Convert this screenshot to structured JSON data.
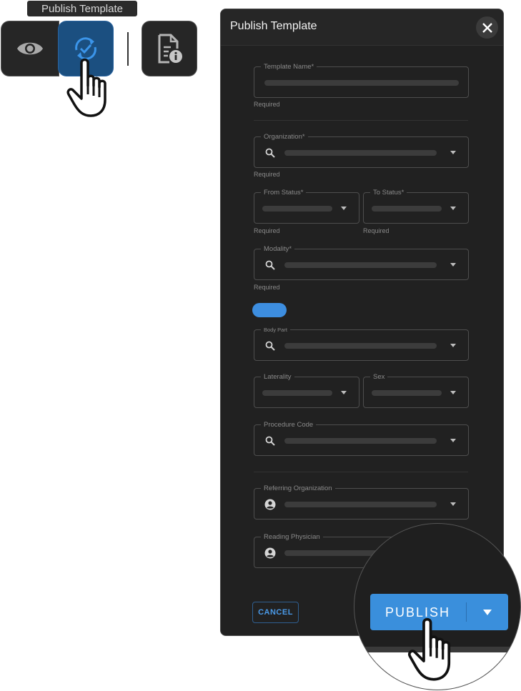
{
  "tooltip": "Publish Template",
  "toolbar": {
    "icons": [
      "eye-icon",
      "sync-check-icon",
      "document-info-icon"
    ]
  },
  "dialog": {
    "title": "Publish Template",
    "fields": {
      "template_name": "Template Name*",
      "organization": "Organization*",
      "from_status": "From Status*",
      "to_status": "To Status*",
      "modality": "Modality*",
      "body_part": "Body Part",
      "laterality": "Laterality",
      "sex": "Sex",
      "procedure_code": "Procedure Code",
      "referring_organization": "Referring Organization",
      "reading_physician": "Reading Physician"
    },
    "helper": "Required",
    "cancel_label": "CANCEL",
    "publish_label": "PUBLISH"
  },
  "colors": {
    "accent": "#3a8fdc",
    "dialog_bg": "#212121",
    "active_button": "#1b4f80"
  }
}
